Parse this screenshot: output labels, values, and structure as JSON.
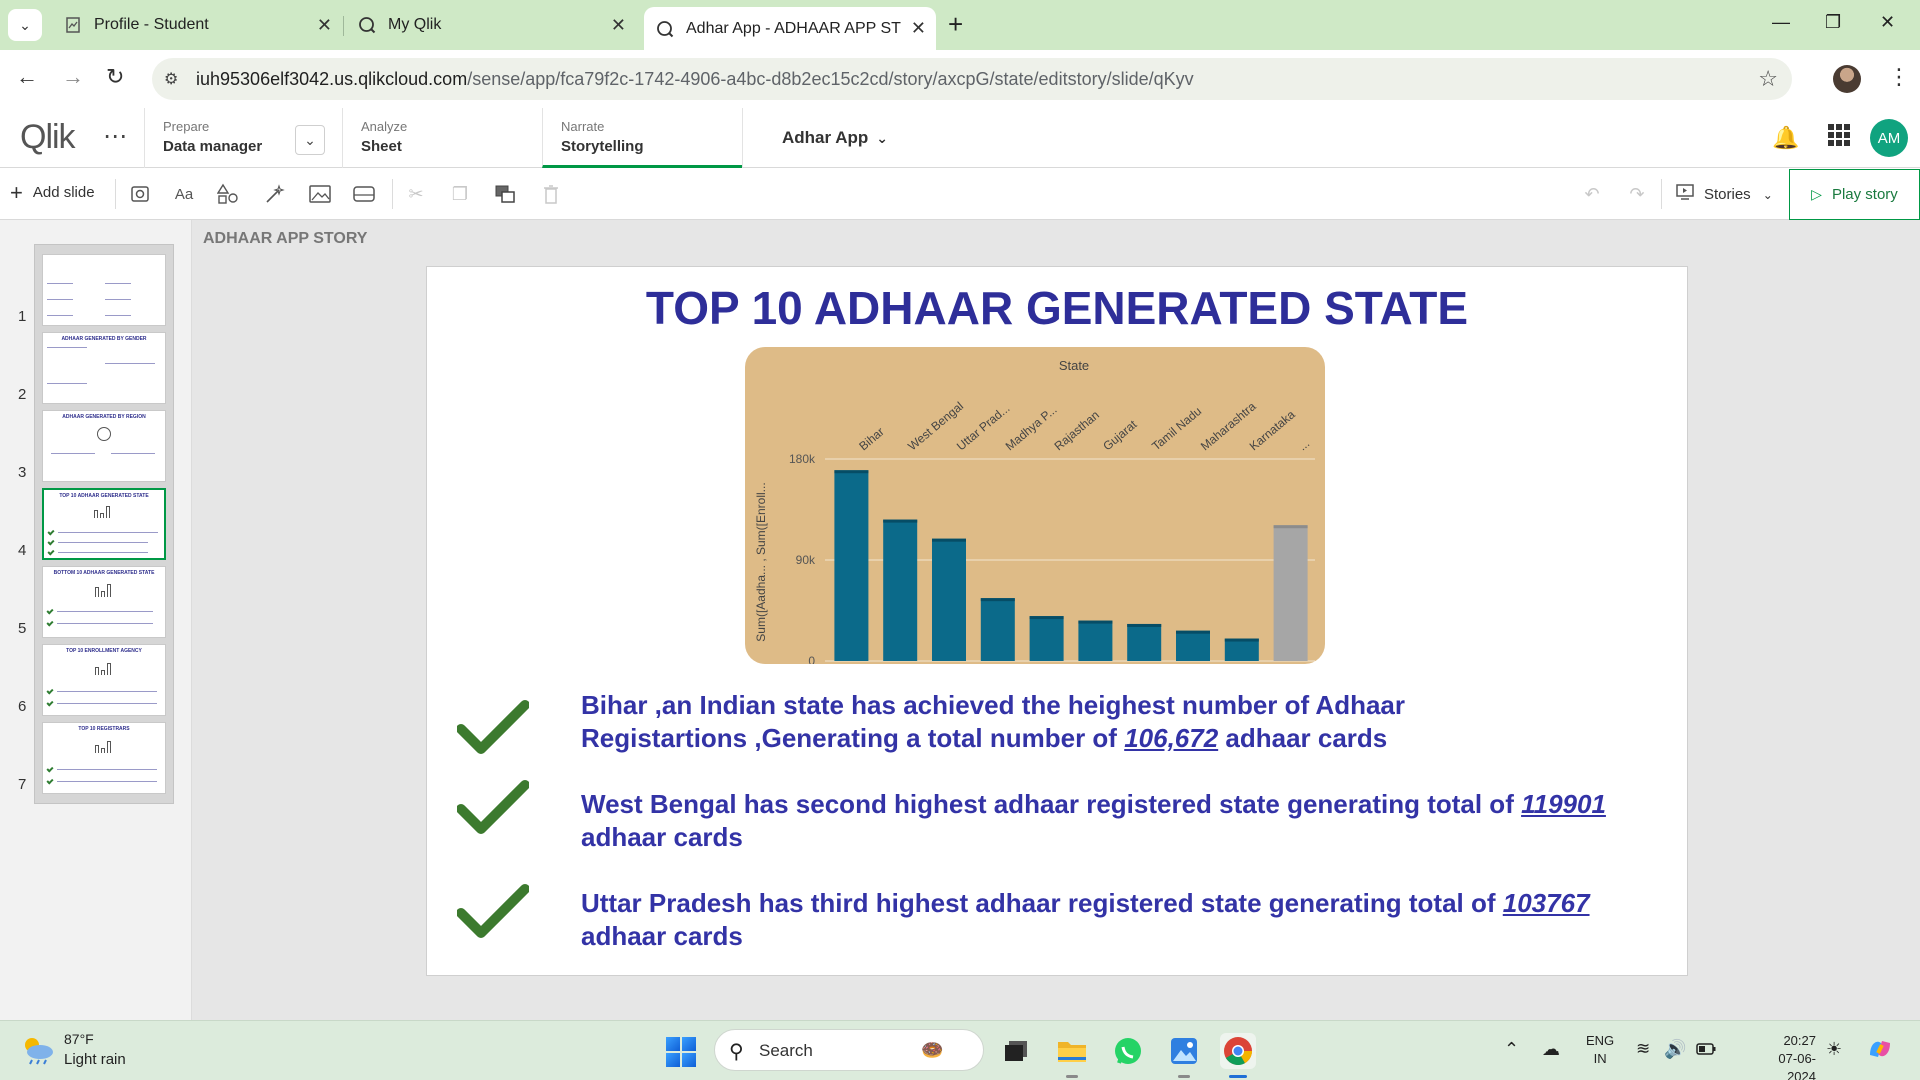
{
  "browser": {
    "tabs": [
      {
        "title": "Profile - Student",
        "icon": "document-icon"
      },
      {
        "title": "My Qlik",
        "icon": "qlik-icon"
      },
      {
        "title": "Adhar App - ADHAAR APP STO",
        "icon": "qlik-icon",
        "active": true
      }
    ],
    "url_host": "iuh95306elf3042.us.qlikcloud.com",
    "url_path": "/sense/app/fca79f2c-1742-4906-a4bc-d8b2ec15c2cd/story/axcpG/state/editstory/slide/qKyv"
  },
  "qlik": {
    "logo": "Qlik",
    "nav": [
      {
        "small": "Prepare",
        "big": "Data manager"
      },
      {
        "small": "Analyze",
        "big": "Sheet"
      },
      {
        "small": "Narrate",
        "big": "Storytelling",
        "active": true
      }
    ],
    "app_name": "Adhar App",
    "avatar": "AM"
  },
  "toolbar": {
    "add_slide": "Add slide",
    "text_tool": "Aa",
    "stories": "Stories",
    "play_story": "Play story"
  },
  "sidebar": {
    "slides": [
      {
        "num": "1",
        "title": ""
      },
      {
        "num": "2",
        "title": "ADHAAR GENERATED BY GENDER"
      },
      {
        "num": "3",
        "title": "ADHAAR GENERATED BY REGION"
      },
      {
        "num": "4",
        "title": "TOP 10 ADHAAR GENERATED STATE",
        "active": true
      },
      {
        "num": "5",
        "title": "BOTTOM 10 ADHAAR GENERATED STATE"
      },
      {
        "num": "6",
        "title": "TOP 10 ENROLLMENT AGENCY"
      },
      {
        "num": "7",
        "title": "TOP 10 REGISTRARS"
      }
    ]
  },
  "canvas": {
    "story_title": "ADHAAR APP STORY"
  },
  "slide": {
    "title": "TOP 10 ADHAAR GENERATED STATE",
    "bullets": [
      {
        "pre": "Bihar ,an Indian state has achieved the heighest number of Adhaar Registartions ,Generating a total number of ",
        "link": "106,672",
        "post": " adhaar cards"
      },
      {
        "pre": "West Bengal has second highest adhaar registered state generating total of ",
        "link": "119901",
        "post": " adhaar cards"
      },
      {
        "pre": "Uttar Pradesh has third highest adhaar registered state generating total of ",
        "link": "103767",
        "post": " adhaar cards"
      }
    ]
  },
  "chart_data": {
    "type": "bar",
    "title": "State",
    "ylabel": "Sum([Aadha... , Sum([Enroll...",
    "categories": [
      "Bihar",
      "West Bengal",
      "Uttar Prad...",
      "Madhya P...",
      "Rajasthan",
      "Gujarat",
      "Tamil Nadu",
      "Maharashtra",
      "Karnataka",
      "..."
    ],
    "values": [
      170000,
      126000,
      109000,
      56000,
      40000,
      36000,
      33000,
      27000,
      20000,
      121000
    ],
    "yticks": [
      {
        "value": 0,
        "label": "0"
      },
      {
        "value": 90000,
        "label": "90k"
      },
      {
        "value": 180000,
        "label": "180k"
      }
    ],
    "ylim": [
      0,
      180000
    ],
    "colors": {
      "bar": "#0b6a8a",
      "others": "#a6a6a6",
      "background": "#debb87"
    }
  },
  "taskbar": {
    "weather_temp": "87°F",
    "weather_desc": "Light rain",
    "search": "Search",
    "lang1": "ENG",
    "lang2": "IN",
    "time": "20:27",
    "date": "07-06-2024"
  }
}
